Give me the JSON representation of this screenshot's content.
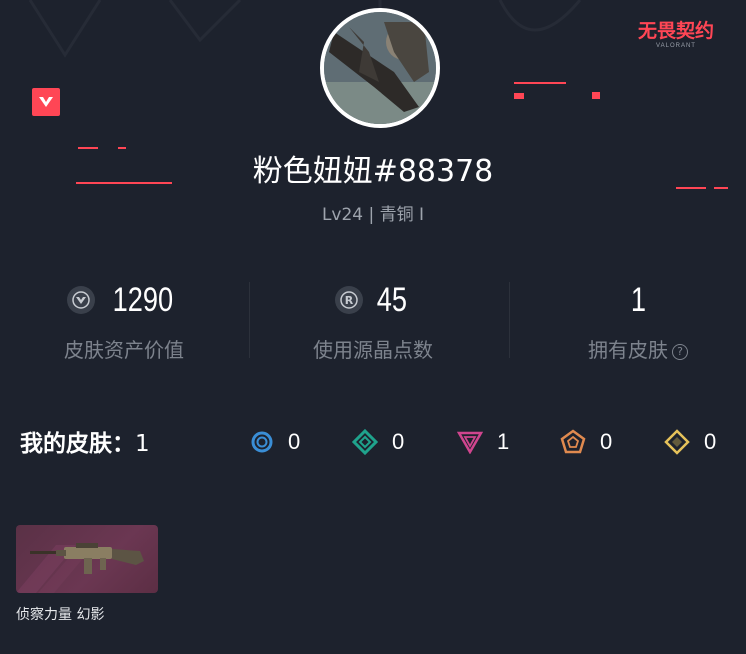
{
  "brand": {
    "name": "无畏契约",
    "subtitle": "VALORANT"
  },
  "profile": {
    "username": "粉色妞妞#88378",
    "level": "Lv24 | 青铜 I"
  },
  "stats": [
    {
      "icon": "valorant-points-icon",
      "value": "1290",
      "label": "皮肤资产价值"
    },
    {
      "icon": "radianite-icon",
      "value": "45",
      "label": "使用源晶点数"
    },
    {
      "icon": "",
      "value": "1",
      "label": "拥有皮肤",
      "help": "?"
    }
  ],
  "skins": {
    "title": "我的皮肤：",
    "count": "1",
    "tiers": [
      {
        "icon": "select-tier-icon",
        "color": "#3a8ed6",
        "count": "0"
      },
      {
        "icon": "deluxe-tier-icon",
        "color": "#1fa38c",
        "count": "0"
      },
      {
        "icon": "premium-tier-icon",
        "color": "#d0458e",
        "count": "1"
      },
      {
        "icon": "exclusive-tier-icon",
        "color": "#e08a4f",
        "count": "0"
      },
      {
        "icon": "ultra-tier-icon",
        "color": "#e6c25a",
        "count": "0"
      }
    ],
    "items": [
      {
        "name": "侦察力量 幻影",
        "card_color": "#653450"
      }
    ]
  },
  "colors": {
    "accent": "#ff4655",
    "background": "#1d222d",
    "muted": "#7d838d"
  }
}
